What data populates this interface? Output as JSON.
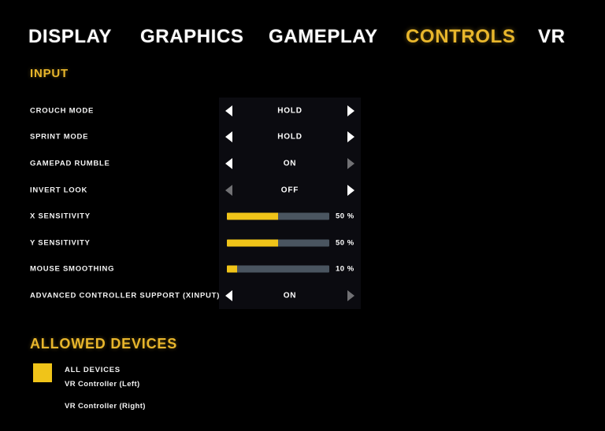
{
  "tabs": [
    {
      "id": "display",
      "label": "DISPLAY",
      "active": false
    },
    {
      "id": "graphics",
      "label": "GRAPHICS",
      "active": false
    },
    {
      "id": "gameplay",
      "label": "GAMEPLAY",
      "active": false
    },
    {
      "id": "controls",
      "label": "CONTROLS",
      "active": true
    },
    {
      "id": "vr",
      "label": "VR",
      "active": false
    }
  ],
  "input_section": {
    "title": "INPUT",
    "rows": [
      {
        "label": "CROUCH MODE",
        "type": "selector",
        "value": "HOLD",
        "left_arrow_enabled": true,
        "right_arrow_enabled": true
      },
      {
        "label": "SPRINT MODE",
        "type": "selector",
        "value": "HOLD",
        "left_arrow_enabled": true,
        "right_arrow_enabled": true
      },
      {
        "label": "GAMEPAD RUMBLE",
        "type": "selector",
        "value": "ON",
        "left_arrow_enabled": true,
        "right_arrow_enabled": false
      },
      {
        "label": "INVERT LOOK",
        "type": "selector",
        "value": "OFF",
        "left_arrow_enabled": false,
        "right_arrow_enabled": true
      },
      {
        "label": "X SENSITIVITY",
        "type": "slider",
        "value": 50,
        "value_label": "50 %"
      },
      {
        "label": "Y SENSITIVITY",
        "type": "slider",
        "value": 50,
        "value_label": "50 %"
      },
      {
        "label": "MOUSE SMOOTHING",
        "type": "slider",
        "value": 10,
        "value_label": "10 %"
      },
      {
        "label": "ADVANCED CONTROLLER SUPPORT (XINPUT)",
        "type": "selector",
        "value": "ON",
        "left_arrow_enabled": true,
        "right_arrow_enabled": false
      }
    ]
  },
  "devices_section": {
    "title": "ALLOWED DEVICES",
    "checkbox_checked": true,
    "items": [
      {
        "label": "ALL DEVICES",
        "emphasis": "strong"
      },
      {
        "label": "VR Controller (Left)",
        "emphasis": "normal"
      },
      {
        "label": "VR Controller (Right)",
        "emphasis": "normal"
      }
    ]
  },
  "colors": {
    "background": "#000000",
    "panel": "#0b0b10",
    "accent_gold": "#e8b62c",
    "slider_fill": "#f0c419",
    "slider_track": "#4a5560",
    "text_primary": "#f2f2f2"
  }
}
